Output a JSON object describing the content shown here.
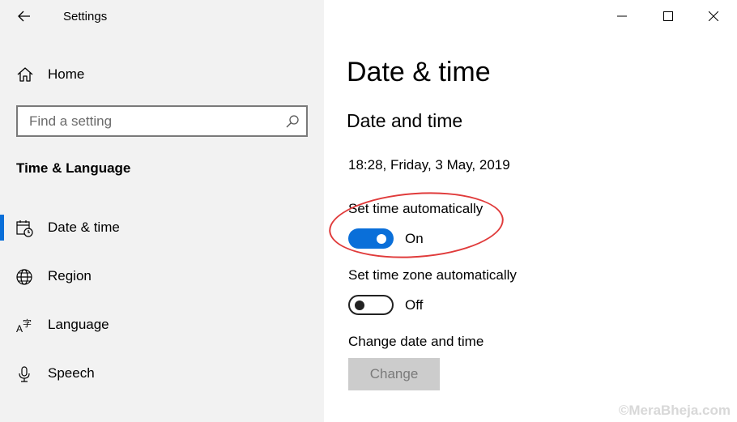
{
  "window": {
    "app_title": "Settings",
    "back_icon": "arrow-left-icon",
    "minimize_icon": "minimize-icon",
    "maximize_icon": "maximize-icon",
    "close_icon": "close-icon"
  },
  "sidebar": {
    "home_label": "Home",
    "home_icon": "home-icon",
    "search": {
      "placeholder": "Find a setting",
      "value": "",
      "icon": "search-icon"
    },
    "section_title": "Time & Language",
    "items": [
      {
        "label": "Date & time",
        "icon": "calendar-clock-icon",
        "active": true
      },
      {
        "label": "Region",
        "icon": "globe-icon",
        "active": false
      },
      {
        "label": "Language",
        "icon": "language-icon",
        "active": false
      },
      {
        "label": "Speech",
        "icon": "microphone-icon",
        "active": false
      }
    ]
  },
  "main": {
    "page_title": "Date & time",
    "sub_title": "Date and time",
    "current_time": "18:28, Friday, 3 May, 2019",
    "set_time_auto": {
      "label": "Set time automatically",
      "state": "On",
      "enabled": true
    },
    "set_timezone_auto": {
      "label": "Set time zone automatically",
      "state": "Off",
      "enabled": false
    },
    "change_date_time": {
      "label": "Change date and time",
      "button_label": "Change"
    }
  },
  "watermark": "©MeraBheja.com",
  "colors": {
    "accent": "#0a6fd9",
    "highlight": "#e03b3b",
    "sidebar_bg": "#f2f2f2"
  }
}
